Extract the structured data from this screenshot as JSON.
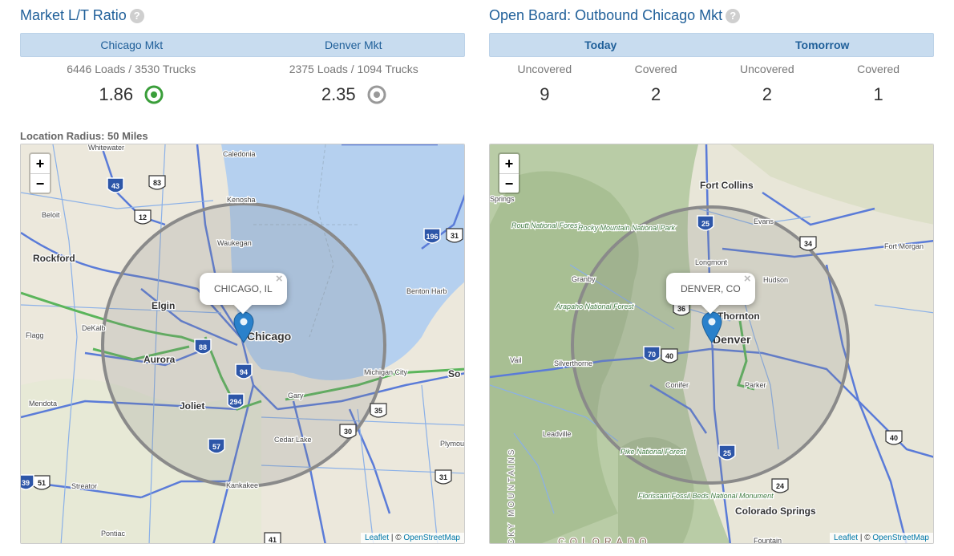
{
  "ratio": {
    "title": "Market L/T Ratio",
    "tabs": [
      "Chicago Mkt",
      "Denver Mkt"
    ],
    "markets": [
      {
        "counts": "6446 Loads / 3530 Trucks",
        "ratio": "1.86",
        "indicator_color": "#3a9e3a"
      },
      {
        "counts": "2375 Loads / 1094 Trucks",
        "ratio": "2.35",
        "indicator_color": "#999999"
      }
    ]
  },
  "board": {
    "title": "Open Board: Outbound Chicago Mkt",
    "tabs": [
      "Today",
      "Tomorrow"
    ],
    "columns": [
      {
        "label": "Uncovered",
        "value": "9"
      },
      {
        "label": "Covered",
        "value": "2"
      },
      {
        "label": "Uncovered",
        "value": "2"
      },
      {
        "label": "Covered",
        "value": "1"
      }
    ]
  },
  "radius_label": "Location Radius: 50 Miles",
  "maps": {
    "chicago": {
      "popup": "CHICAGO, IL",
      "close": "×",
      "zoom_in": "+",
      "zoom_out": "−",
      "places": [
        "Whitewater",
        "Caledonia",
        "Kenosha",
        "Beloit",
        "Waukegan",
        "Rockford",
        "Elgin",
        "Chicago",
        "DeKalb",
        "Aurora",
        "Flagg",
        "Joliet",
        "Gary",
        "Benton Harb",
        "Michigan City",
        "Mendota",
        "Cedar Lake",
        "Plymou",
        "Streator",
        "Kankakee",
        "Pontiac",
        "So"
      ],
      "shields": [
        "43",
        "83",
        "12",
        "196",
        "31",
        "88",
        "94",
        "294",
        "35",
        "30",
        "57",
        "51",
        "31",
        "41",
        "39"
      ]
    },
    "denver": {
      "popup": "DENVER, CO",
      "close": "×",
      "zoom_in": "+",
      "zoom_out": "−",
      "places": [
        "Springs",
        "Fort Collins",
        "Evans",
        "Routt National Forest",
        "Rocky Mountain National Park",
        "Fort Morgan",
        "Longmont",
        "Granby",
        "Hudson",
        "Arapaho National Forest",
        "Thornton",
        "Denver",
        "Vail",
        "Silverthorne",
        "Parker",
        "Conifer",
        "Leadville",
        "Pike National Forest",
        "Florissant Fossil Beds National Monument",
        "Colorado Springs",
        "Fountain",
        "ROCKY MOUNTAINS",
        "COLORADO"
      ],
      "shields": [
        "25",
        "34",
        "36",
        "70",
        "40",
        "25",
        "40",
        "24"
      ]
    },
    "attribution": {
      "leaflet": "Leaflet",
      "sep": " | © ",
      "osm": "OpenStreetMap"
    }
  },
  "colors": {
    "accent": "#1f5f99",
    "tab_bg": "#c8dcef",
    "green": "#3a9e3a",
    "gray_indicator": "#999999",
    "pin": "#2a81cb",
    "radius": "#8a8a8a"
  }
}
